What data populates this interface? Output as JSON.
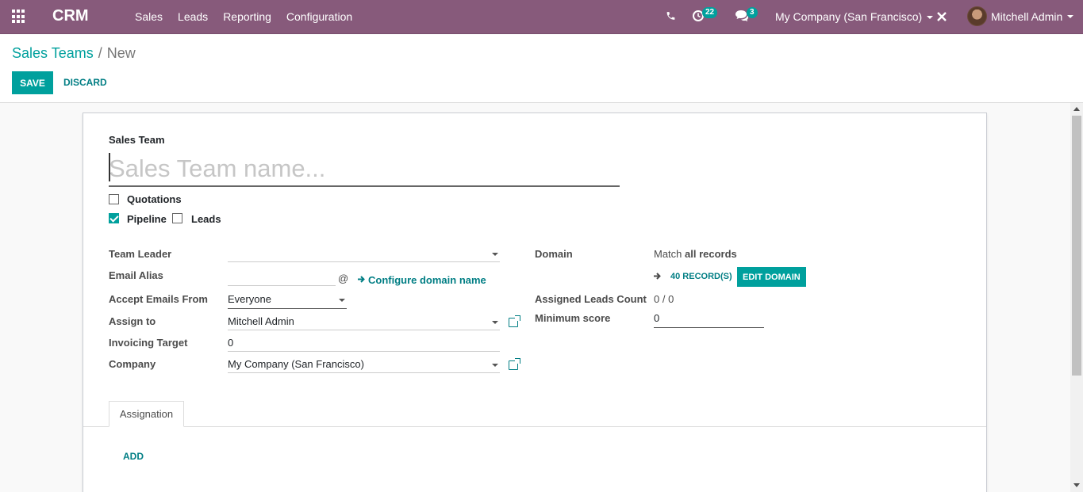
{
  "navbar": {
    "brand": "CRM",
    "menu": [
      "Sales",
      "Leads",
      "Reporting",
      "Configuration"
    ],
    "activities_count": "22",
    "messages_count": "3",
    "company": "My Company (San Francisco)",
    "user": "Mitchell Admin"
  },
  "breadcrumb": {
    "parent": "Sales Teams",
    "separator": "/",
    "current": "New"
  },
  "buttons": {
    "save": "Save",
    "discard": "Discard"
  },
  "form": {
    "title_label": "Sales Team",
    "name_placeholder": "Sales Team name...",
    "checkboxes": {
      "quotations": {
        "label": "Quotations",
        "checked": false
      },
      "pipeline": {
        "label": "Pipeline",
        "checked": true
      },
      "leads": {
        "label": "Leads",
        "checked": false
      }
    },
    "team_leader": {
      "label": "Team Leader",
      "value": ""
    },
    "email_alias": {
      "label": "Email Alias",
      "value": "",
      "at": "@",
      "configure": "Configure domain name"
    },
    "accept_emails": {
      "label": "Accept Emails From",
      "value": "Everyone"
    },
    "assign_to": {
      "label": "Assign to",
      "value": "Mitchell Admin"
    },
    "invoicing_target": {
      "label": "Invoicing Target",
      "value": "0"
    },
    "company": {
      "label": "Company",
      "value": "My Company (San Francisco)"
    },
    "domain": {
      "label": "Domain",
      "match_prefix": "Match",
      "match_value": "all records",
      "records": "40 RECORD(S)",
      "edit": "Edit Domain"
    },
    "assigned_leads": {
      "label": "Assigned Leads Count",
      "value": "0 / 0"
    },
    "minimum_score": {
      "label": "Minimum score",
      "value": "0"
    }
  },
  "tabs": {
    "assignation": "Assignation"
  },
  "add_label": "Add",
  "colors": {
    "primary": "#875a7b",
    "accent": "#00a09d",
    "link": "#017e84"
  }
}
